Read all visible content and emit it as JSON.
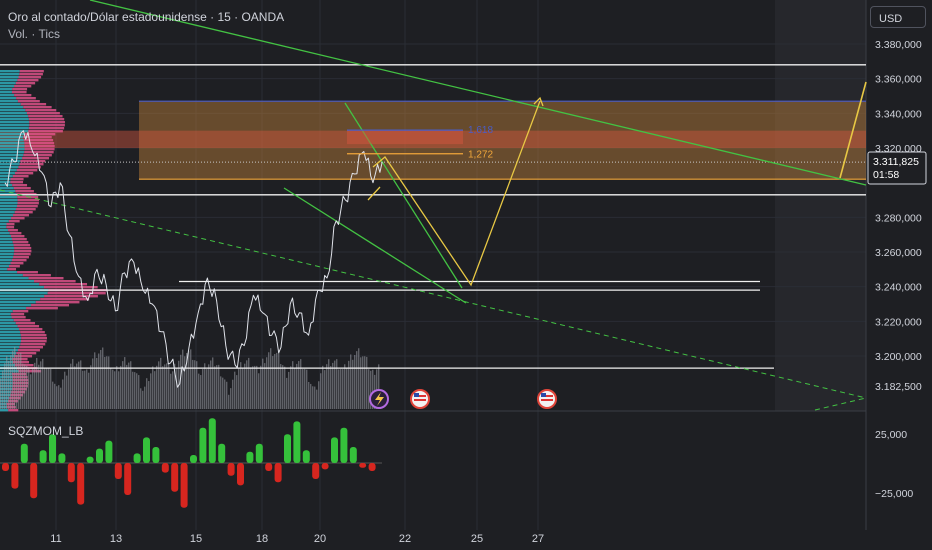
{
  "header": {
    "symbol_title": "Oro al contado/Dólar estadounidense · 15 · OANDA",
    "volume_label": "Vol. · Tics",
    "currency_button": "USD"
  },
  "indicator": {
    "name": "SQZMOM_LB"
  },
  "price_tag": {
    "price": "3.311,825",
    "countdown": "01:58"
  },
  "fib_labels": {
    "level_1": "1,618",
    "level_2": "1,272"
  },
  "colors": {
    "background": "#1e1f23",
    "grid": "#2a2d35",
    "price_line": "#e0e3ea",
    "volume": "#9598a1",
    "volume_profile_up": "#2fb5c4",
    "volume_profile_down": "#e9548e",
    "zone_fill": "#c2813a",
    "zone_red": "#d2553e",
    "trendline": "#43c243",
    "projection": "#e8c844",
    "fib_blue": "#4a5cc8",
    "fib_orange": "#f0a63a",
    "momentum_pos": "#35c13b",
    "momentum_neg": "#d7261f"
  },
  "chart_data": {
    "type": "line",
    "title": "Oro al contado/Dólar estadounidense · 15 · OANDA",
    "xlabel": "",
    "ylabel": "",
    "x_tick_labels": [
      "11",
      "13",
      "15",
      "18",
      "20",
      "22",
      "25",
      "27"
    ],
    "y_tick_labels": [
      "3.380,000",
      "3.360,000",
      "3.340,000",
      "3.320,000",
      "3.280,000",
      "3.260,000",
      "3.240,000",
      "3.220,000",
      "3.200,000",
      "3.182,500"
    ],
    "ylim": [
      3170,
      3392
    ],
    "last_price": 3311.825,
    "price_series": [
      {
        "x": 0,
        "y": 3300
      },
      {
        "x": 1,
        "y": 3312
      },
      {
        "x": 2,
        "y": 3330
      },
      {
        "x": 3,
        "y": 3318
      },
      {
        "x": 4,
        "y": 3306
      },
      {
        "x": 5,
        "y": 3286
      },
      {
        "x": 6,
        "y": 3300
      },
      {
        "x": 7,
        "y": 3270
      },
      {
        "x": 8,
        "y": 3246
      },
      {
        "x": 9,
        "y": 3232
      },
      {
        "x": 10,
        "y": 3250
      },
      {
        "x": 11,
        "y": 3241
      },
      {
        "x": 12,
        "y": 3226
      },
      {
        "x": 13,
        "y": 3248
      },
      {
        "x": 14,
        "y": 3254
      },
      {
        "x": 15,
        "y": 3238
      },
      {
        "x": 16,
        "y": 3230
      },
      {
        "x": 17,
        "y": 3214
      },
      {
        "x": 18,
        "y": 3196
      },
      {
        "x": 19,
        "y": 3184
      },
      {
        "x": 20,
        "y": 3205
      },
      {
        "x": 21,
        "y": 3225
      },
      {
        "x": 22,
        "y": 3245
      },
      {
        "x": 23,
        "y": 3232
      },
      {
        "x": 24,
        "y": 3206
      },
      {
        "x": 25,
        "y": 3195
      },
      {
        "x": 26,
        "y": 3206
      },
      {
        "x": 27,
        "y": 3235
      },
      {
        "x": 28,
        "y": 3225
      },
      {
        "x": 29,
        "y": 3212
      },
      {
        "x": 30,
        "y": 3205
      },
      {
        "x": 31,
        "y": 3230
      },
      {
        "x": 32,
        "y": 3225
      },
      {
        "x": 33,
        "y": 3212
      },
      {
        "x": 34,
        "y": 3238
      },
      {
        "x": 35,
        "y": 3245
      },
      {
        "x": 36,
        "y": 3278
      },
      {
        "x": 37,
        "y": 3290
      },
      {
        "x": 38,
        "y": 3305
      },
      {
        "x": 39,
        "y": 3318
      },
      {
        "x": 40,
        "y": 3300
      },
      {
        "x": 41,
        "y": 3312
      }
    ],
    "horizontal_levels": [
      3368,
      3293,
      3243,
      3238,
      3193
    ],
    "zone": {
      "top": 3347,
      "bottom": 3302
    },
    "red_zone": {
      "top": 3330,
      "bottom": 3320
    },
    "fib_levels": [
      {
        "label": "1,618",
        "value": 3328
      },
      {
        "label": "1,272",
        "value": 3319
      }
    ],
    "momentum_range": [
      -35000,
      35000
    ],
    "momentum_ticks": [
      "25,000",
      "−25,000"
    ],
    "momentum": [
      -5000,
      -16000,
      12000,
      -22000,
      8000,
      18000,
      6000,
      -12000,
      -26000,
      4000,
      9000,
      14000,
      -10000,
      -20000,
      6000,
      16000,
      10000,
      -6000,
      -18000,
      -28000,
      5000,
      22000,
      28000,
      12000,
      -8000,
      -14000,
      7000,
      12000,
      -5000,
      -12000,
      18000,
      26000,
      8000,
      -10000,
      -4000,
      16000,
      22000,
      10000,
      -3000,
      -5000
    ]
  }
}
